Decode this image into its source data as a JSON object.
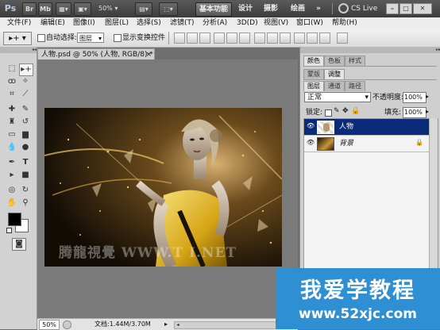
{
  "app": {
    "logo": "Ps",
    "br_label": "Br",
    "mb_label": "Mb",
    "zoom": "50%",
    "workspaces": [
      "基本功能",
      "设计",
      "摄影",
      "绘画"
    ],
    "more": "»",
    "cslive": "CS Live"
  },
  "menu": [
    "文件(F)",
    "编辑(E)",
    "图像(I)",
    "图层(L)",
    "选择(S)",
    "滤镜(T)",
    "分析(A)",
    "3D(D)",
    "视图(V)",
    "窗口(W)",
    "帮助(H)"
  ],
  "options": {
    "auto_select_label": "自动选择:",
    "auto_select_value": "图层",
    "show_transform_label": "显示变换控件"
  },
  "document": {
    "tab_title": "人物.psd @ 50% (人物, RGB/8) *",
    "close": "×",
    "status_zoom": "50%",
    "status_doc": "文档:1.44M/3.70M",
    "watermark": "腾龍視覺 WWW.T      I.NET"
  },
  "panels": {
    "group1_tabs": [
      "颜色",
      "色板",
      "样式"
    ],
    "group2_tabs": [
      "蒙版",
      "调整"
    ],
    "group3_tabs": [
      "图层",
      "通道",
      "路径"
    ],
    "blend_mode": "正常",
    "opacity_label": "不透明度:",
    "opacity_value": "100%",
    "lock_label": "锁定:",
    "fill_label": "填充:",
    "fill_value": "100%",
    "layers": [
      {
        "name": "人物",
        "selected": true
      },
      {
        "name": "背景",
        "selected": false,
        "locked": true
      }
    ]
  },
  "banner": {
    "title": "我爱学教程",
    "url": "www.52xjc.com"
  },
  "colors": {
    "selected_layer": "#0b2a7a",
    "banner": "#2f8fd3",
    "appbar": "#3c3c3c"
  }
}
